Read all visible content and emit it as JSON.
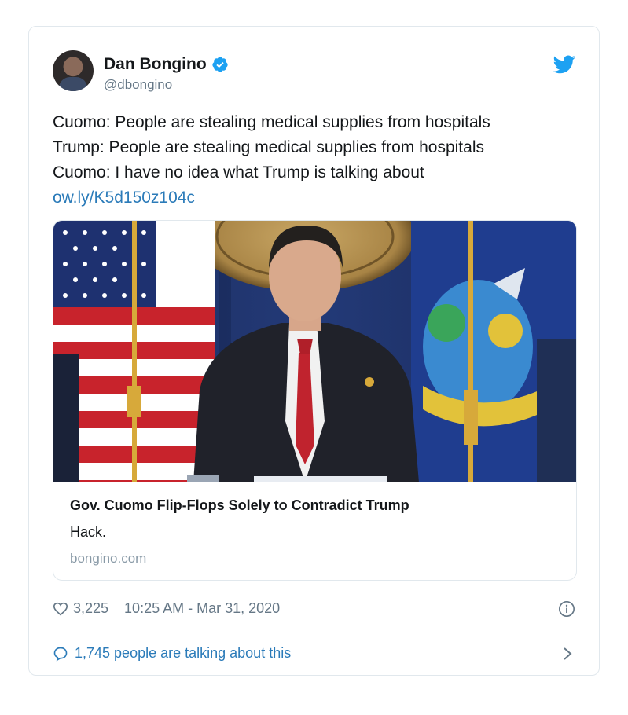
{
  "author": {
    "name": "Dan Bongino",
    "handle": "@dbongino",
    "avatar_icon": "avatar-photo",
    "verified_icon": "verified-badge-icon"
  },
  "platform_icon": "twitter-bird-icon",
  "tweet": {
    "lines": [
      "Cuomo: People are stealing medical supplies from hospitals",
      "Trump: People are stealing medical supplies from hospitals",
      "Cuomo: I have no idea what Trump is talking about"
    ],
    "link": "ow.ly/K5d150z104c"
  },
  "card": {
    "title": "Gov. Cuomo Flip-Flops Solely to Contradict Trump",
    "description": "Hack.",
    "domain": "bongino.com"
  },
  "meta": {
    "likes": "3,225",
    "timestamp": "10:25 AM - Mar 31, 2020"
  },
  "footer": {
    "talking": "1,745 people are talking about this"
  },
  "colors": {
    "accent": "#1da1f2",
    "link": "#2b7bb9",
    "muted": "#657786",
    "border": "#e1e8ed"
  }
}
